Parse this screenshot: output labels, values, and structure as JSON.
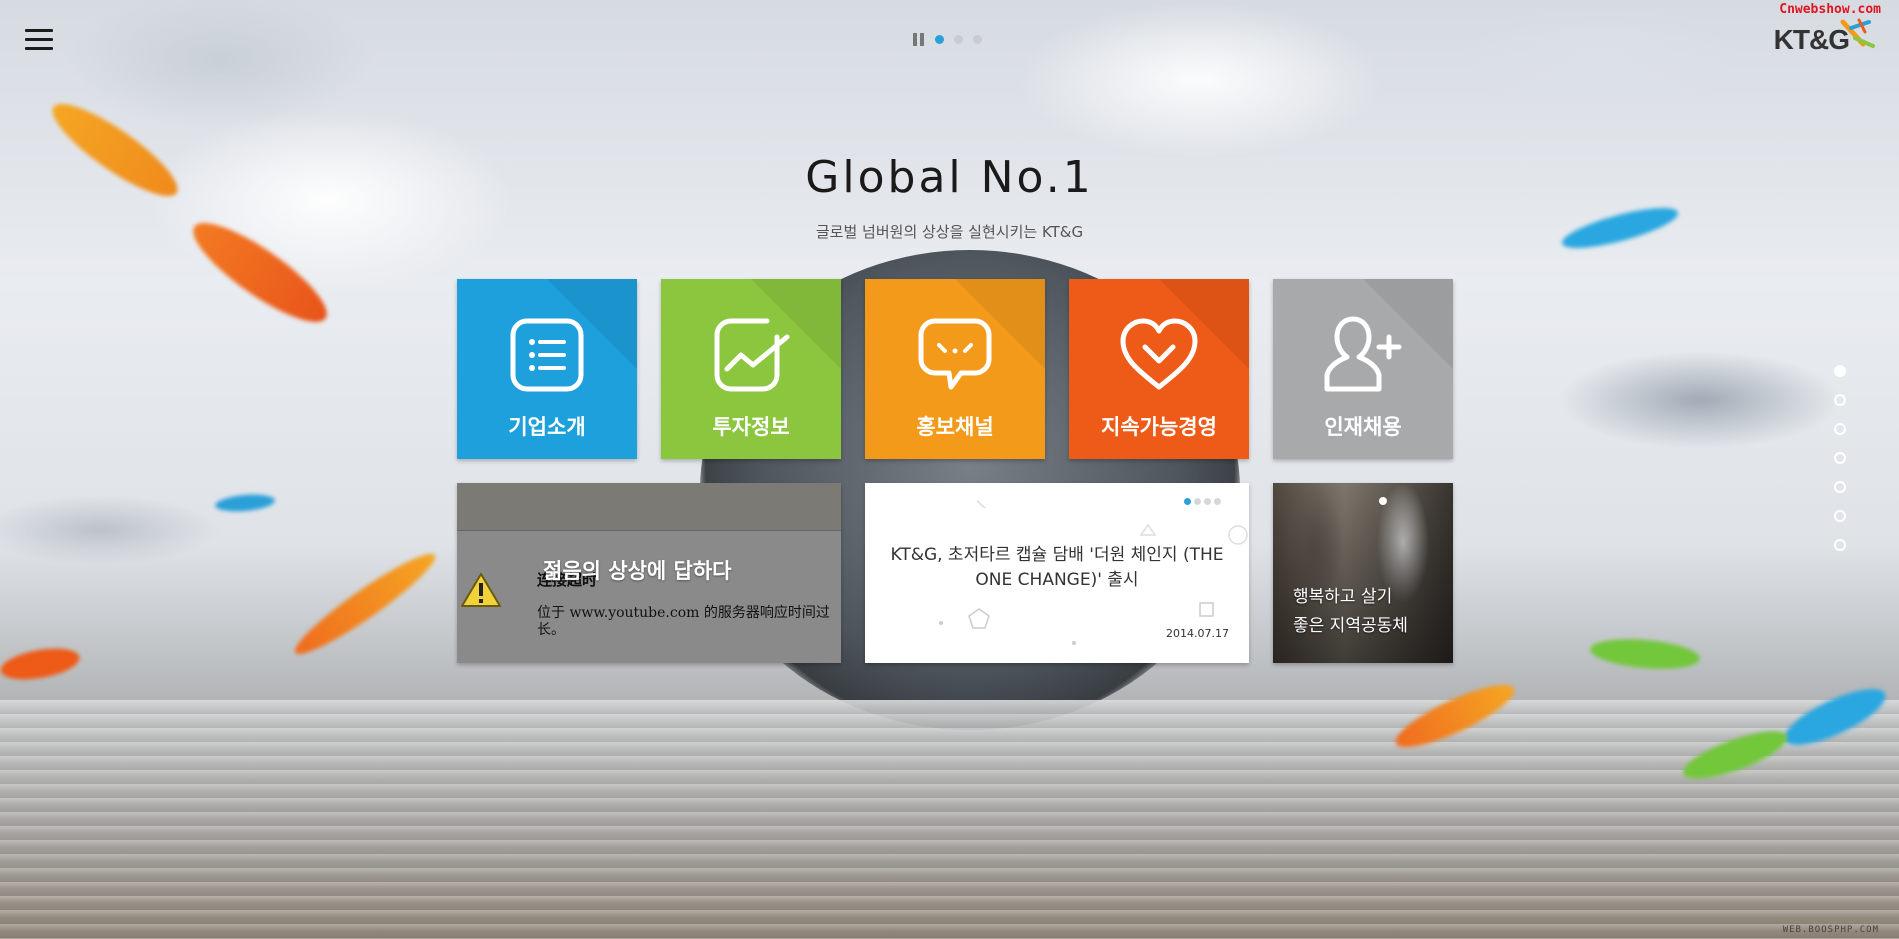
{
  "header": {
    "menu_icon": "hamburger-menu-icon",
    "watermark": "Cnwebshow.com",
    "logo_text": "KT&G",
    "slider": {
      "pause_icon": "pause-icon",
      "dots": 3,
      "active": 0
    }
  },
  "hero": {
    "title": "Global No.1",
    "subtitle": "글로벌 넘버원의 상상을 실현시키는 KT&G"
  },
  "tiles": [
    {
      "label": "기업소개",
      "icon": "list-icon",
      "color": "#1ea0dd"
    },
    {
      "label": "투자정보",
      "icon": "chart-trend-icon",
      "color": "#8cc63f"
    },
    {
      "label": "홍보채널",
      "icon": "speech-bubble-icon",
      "color": "#f39a1a"
    },
    {
      "label": "지속가능경영",
      "icon": "heart-icon",
      "color": "#ee5a17"
    },
    {
      "label": "인재채용",
      "icon": "add-user-icon",
      "color": "#a8a9aa"
    }
  ],
  "video_card": {
    "caption": "젊음의 상상에 답하다",
    "error_title": "连接超时",
    "error_message": "位于 www.youtube.com 的服务器响应时间过长。"
  },
  "news_card": {
    "dots": 4,
    "active": 0,
    "text": "KT&G, 초저타르 캡슐 담배 '더원 체인지 (THE ONE CHANGE)' 출시",
    "date": "2014.07.17"
  },
  "photo_card": {
    "text_line1": "행복하고 살기",
    "text_line2": "좋은 지역공동체"
  },
  "side_nav": {
    "count": 7,
    "active": 0
  },
  "footer": {
    "mark": "WEB.BOOSPHP.COM"
  }
}
